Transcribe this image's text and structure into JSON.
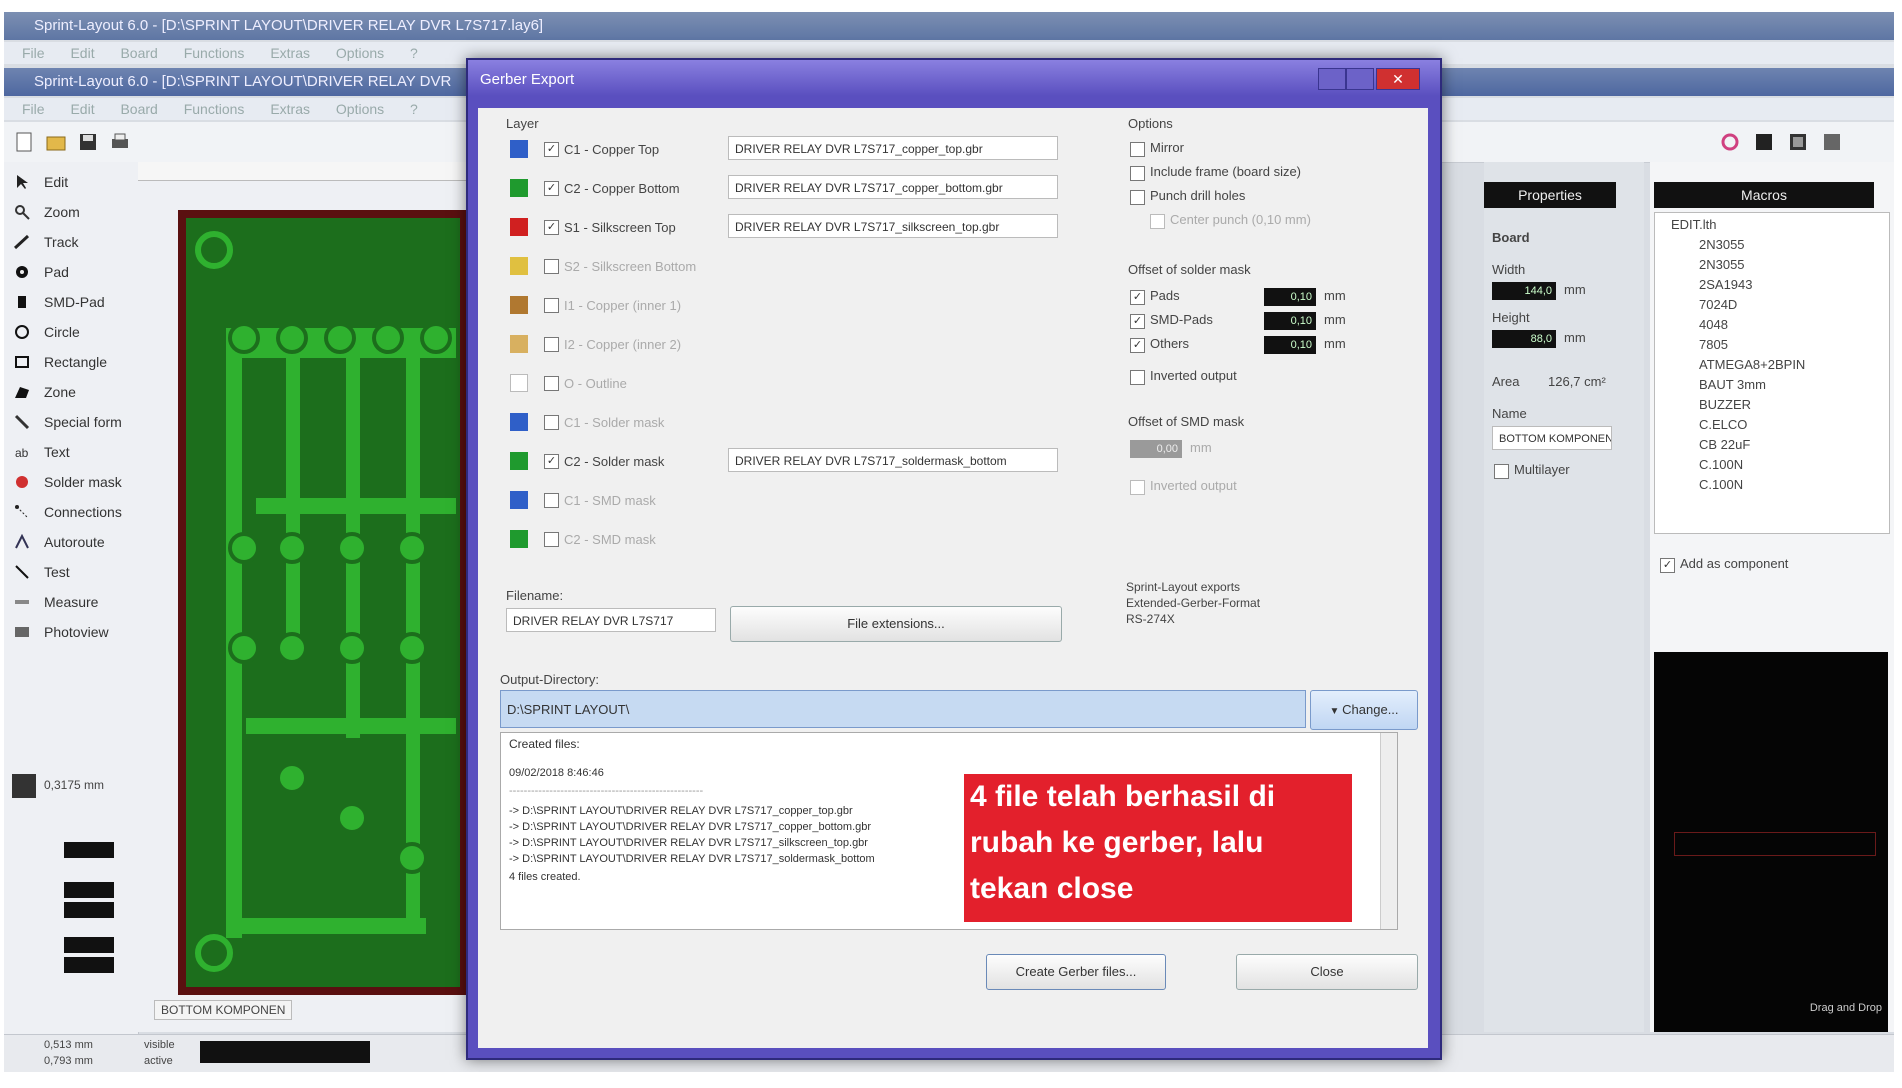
{
  "app": {
    "back_title": "Sprint-Layout 6.0 - [D:\\SPRINT LAYOUT\\DRIVER RELAY DVR L7S717.lay6]",
    "front_title": "Sprint-Layout 6.0 - [D:\\SPRINT LAYOUT\\DRIVER RELAY DVR",
    "menu": [
      "File",
      "Edit",
      "Board",
      "Functions",
      "Extras",
      "Options",
      "?"
    ]
  },
  "tools": [
    {
      "label": "Edit",
      "icon": "cursor-icon"
    },
    {
      "label": "Zoom",
      "icon": "zoom-icon"
    },
    {
      "label": "Track",
      "icon": "track-icon"
    },
    {
      "label": "Pad",
      "icon": "pad-icon"
    },
    {
      "label": "SMD-Pad",
      "icon": "smd-pad-icon"
    },
    {
      "label": "Circle",
      "icon": "circle-icon"
    },
    {
      "label": "Rectangle",
      "icon": "rectangle-icon"
    },
    {
      "label": "Zone",
      "icon": "zone-icon"
    },
    {
      "label": "Special form",
      "icon": "special-form-icon"
    },
    {
      "label": "Text",
      "icon": "text-icon"
    },
    {
      "label": "Solder mask",
      "icon": "solder-mask-icon"
    },
    {
      "label": "Connections",
      "icon": "connections-icon"
    },
    {
      "label": "Autoroute",
      "icon": "autoroute-icon"
    },
    {
      "label": "Test",
      "icon": "test-icon"
    },
    {
      "label": "Measure",
      "icon": "measure-icon"
    },
    {
      "label": "Photoview",
      "icon": "photoview-icon"
    }
  ],
  "grid": "0,3175 mm",
  "board_tab": "BOTTOM KOMPONEN",
  "status": {
    "x": "0,513 mm",
    "y": "0,793 mm",
    "visible": "visible",
    "active": "active"
  },
  "props": {
    "header": "Properties",
    "board_label": "Board",
    "width_label": "Width",
    "width_val": "144,0",
    "unit": "mm",
    "height_label": "Height",
    "height_val": "88,0",
    "area_label": "Area",
    "area_val": "126,7 cm²",
    "name_label": "Name",
    "name_val": "BOTTOM KOMPONEN",
    "multilayer": "Multilayer"
  },
  "macros": {
    "header": "Macros",
    "root": "EDIT.lth",
    "items": [
      "2N3055",
      "2N3055",
      "2SA1943",
      "7024D",
      "4048",
      "7805",
      "ATMEGA8+2BPIN",
      "BAUT 3mm",
      "BUZZER",
      "C.ELCO",
      "CB 22uF",
      "C.100N",
      "C.100N"
    ],
    "add_component": "Add as component",
    "footer": "Drag and Drop"
  },
  "dialog": {
    "title": "Gerber Export",
    "layer_heading": "Layer",
    "layers": [
      {
        "label": "C1 - Copper Top",
        "checked": "✓",
        "file": "DRIVER RELAY DVR L7S717_copper_top.gbr",
        "color": "#2f5fc8",
        "enabled": true
      },
      {
        "label": "C2 - Copper Bottom",
        "checked": "✓",
        "file": "DRIVER RELAY DVR L7S717_copper_bottom.gbr",
        "color": "#1f9a2e",
        "enabled": true
      },
      {
        "label": "S1 - Silkscreen Top",
        "checked": "✓",
        "file": "DRIVER RELAY DVR L7S717_silkscreen_top.gbr",
        "color": "#d02020",
        "enabled": true
      },
      {
        "label": "S2 - Silkscreen Bottom",
        "checked": "",
        "file": "",
        "color": "#e0c040",
        "enabled": false
      },
      {
        "label": "I1 - Copper (inner 1)",
        "checked": "",
        "file": "",
        "color": "#b07830",
        "enabled": false
      },
      {
        "label": "I2 - Copper (inner 2)",
        "checked": "",
        "file": "",
        "color": "#d8b060",
        "enabled": false
      },
      {
        "label": "O - Outline",
        "checked": "",
        "file": "",
        "color": "#ffffff",
        "enabled": false
      },
      {
        "label": "C1 - Solder mask",
        "checked": "",
        "file": "",
        "color": "#2f5fc8",
        "enabled": false
      },
      {
        "label": "C2 - Solder mask",
        "checked": "✓",
        "file": "DRIVER RELAY DVR L7S717_soldermask_bottom",
        "color": "#1f9a2e",
        "enabled": true
      },
      {
        "label": "C1 - SMD mask",
        "checked": "",
        "file": "",
        "color": "#2f5fc8",
        "enabled": false
      },
      {
        "label": "C2 - SMD mask",
        "checked": "",
        "file": "",
        "color": "#1f9a2e",
        "enabled": false
      }
    ],
    "filename_label": "Filename:",
    "filename_val": "DRIVER RELAY DVR L7S717",
    "file_ext_btn": "File extensions...",
    "options": {
      "heading": "Options",
      "items": [
        {
          "label": "Mirror",
          "checked": "",
          "enabled": true
        },
        {
          "label": "Include frame (board size)",
          "checked": "",
          "enabled": true
        },
        {
          "label": "Punch drill holes",
          "checked": "",
          "enabled": true
        },
        {
          "label": "Center punch (0,10 mm)",
          "checked": "",
          "enabled": false
        }
      ]
    },
    "solder_offset": {
      "heading": "Offset of solder mask",
      "items": [
        {
          "label": "Pads",
          "val": "0,10",
          "checked": "✓"
        },
        {
          "label": "SMD-Pads",
          "val": "0,10",
          "checked": "✓"
        },
        {
          "label": "Others",
          "val": "0,10",
          "checked": "✓"
        }
      ],
      "unit": "mm",
      "inverted": "Inverted output"
    },
    "smd_offset": {
      "heading": "Offset of SMD mask",
      "val": "0,00",
      "unit": "mm",
      "inverted": "Inverted output"
    },
    "info": [
      "Sprint-Layout exports",
      "Extended-Gerber-Format",
      "RS-274X"
    ],
    "output_label": "Output-Directory:",
    "output_val": "D:\\SPRINT LAYOUT\\",
    "change_btn": "Change...",
    "log": [
      "Created files:",
      "09/02/2018 8:46:46",
      "-----------------------------------------------------",
      "-> D:\\SPRINT LAYOUT\\DRIVER RELAY DVR L7S717_copper_top.gbr",
      "-> D:\\SPRINT LAYOUT\\DRIVER RELAY DVR L7S717_copper_bottom.gbr",
      "-> D:\\SPRINT LAYOUT\\DRIVER RELAY DVR L7S717_silkscreen_top.gbr",
      "-> D:\\SPRINT LAYOUT\\DRIVER RELAY DVR L7S717_soldermask_bottom",
      "4 files created."
    ],
    "create_btn": "Create Gerber files...",
    "close_btn": "Close"
  },
  "callout": [
    "4 file telah berhasil di",
    "rubah ke gerber, lalu",
    "tekan close"
  ]
}
